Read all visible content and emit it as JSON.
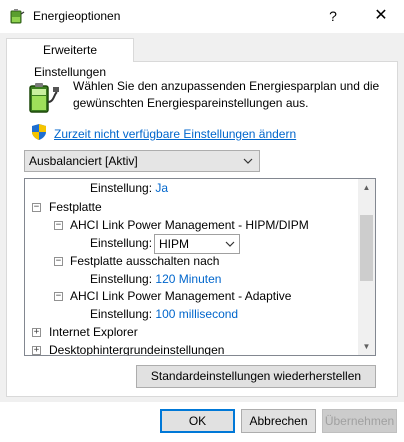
{
  "window": {
    "title": "Energieoptionen",
    "help": "?",
    "close": "✕"
  },
  "tab": {
    "label": "Erweiterte Einstellungen"
  },
  "intro": {
    "text": "Wählen Sie den anzupassenden Energiesparplan und die gewünschten Energiespareinstellungen aus."
  },
  "link": {
    "text": "Zurzeit nicht verfügbare Einstellungen ändern"
  },
  "plan_select": {
    "value": "Ausbalanciert [Aktiv]"
  },
  "tree": {
    "row0": {
      "label": "Einstellung:",
      "value": "Ja"
    },
    "festplatte": {
      "label": "Festplatte"
    },
    "ahci_hipm": {
      "label": "AHCI Link Power Management - HIPM/DIPM"
    },
    "ahci_hipm_setting": {
      "label": "Einstellung:",
      "value": "HIPM"
    },
    "disk_off": {
      "label": "Festplatte ausschalten nach"
    },
    "disk_off_setting": {
      "label": "Einstellung:",
      "value": "120 Minuten"
    },
    "ahci_adaptive": {
      "label": "AHCI Link Power Management - Adaptive"
    },
    "ahci_adaptive_setting": {
      "label": "Einstellung:",
      "value": "100 millisecond"
    },
    "internet_explorer": {
      "label": "Internet Explorer"
    },
    "desktop_bg": {
      "label": "Desktophintergrundeinstellungen"
    },
    "expand_plus": "+",
    "collapse_minus": "−"
  },
  "buttons": {
    "restore": "Standardeinstellungen wiederherstellen",
    "ok": "OK",
    "cancel": "Abbrechen",
    "apply": "Übernehmen"
  },
  "colors": {
    "link": "#0066cc",
    "value": "#0066cc",
    "panel_bg": "#f0f0f0",
    "focus": "#0078d7"
  },
  "icons": {
    "app": "battery-plug-icon",
    "battery": "battery-plug-icon",
    "shield": "uac-shield-icon",
    "chevron": "chevron-down-icon"
  }
}
